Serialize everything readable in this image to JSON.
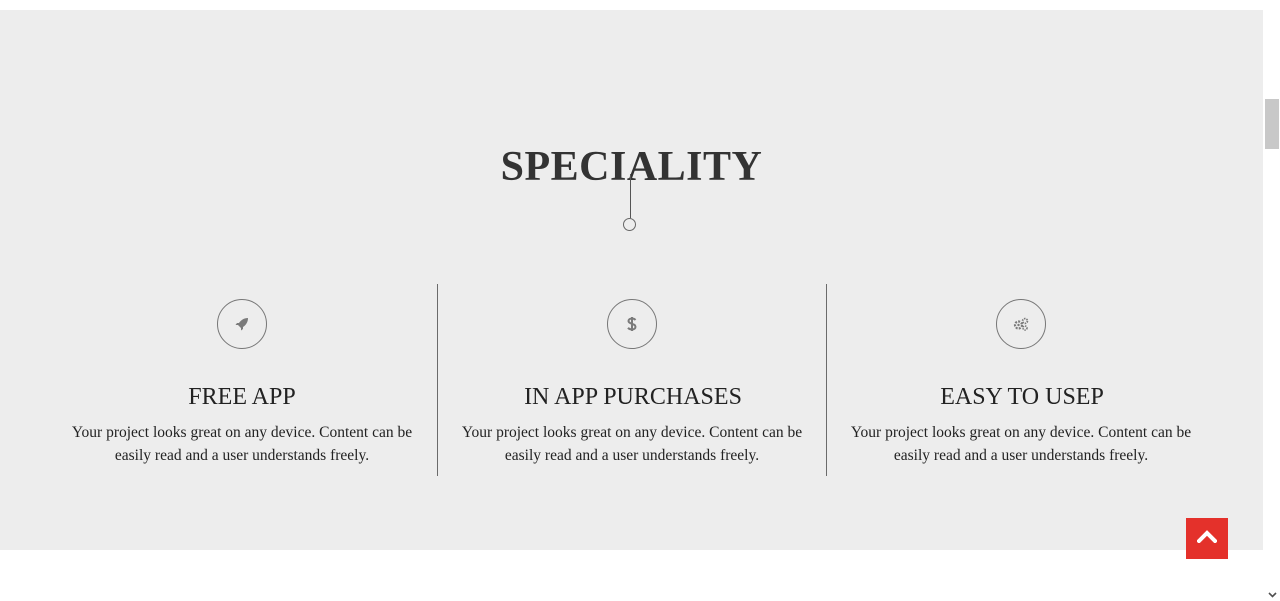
{
  "section": {
    "title": "SPECIALITY"
  },
  "features": [
    {
      "icon": "rocket-icon",
      "title": "FREE APP",
      "description": "Your project looks great on any device. Content can be easily read and a user understands freely."
    },
    {
      "icon": "dollar-icon",
      "title": "IN APP PURCHASES",
      "description": "Your project looks great on any device. Content can be easily read and a user understands freely."
    },
    {
      "icon": "gears-icon",
      "title": "EASY TO USEP",
      "description": "Your project looks great on any device. Content can be easily read and a user understands freely."
    }
  ],
  "colors": {
    "section_background": "#ededed",
    "accent": "#e4312b",
    "text": "#222222",
    "icon": "#777777"
  },
  "scroll_top": {
    "icon": "chevron-up-icon"
  }
}
